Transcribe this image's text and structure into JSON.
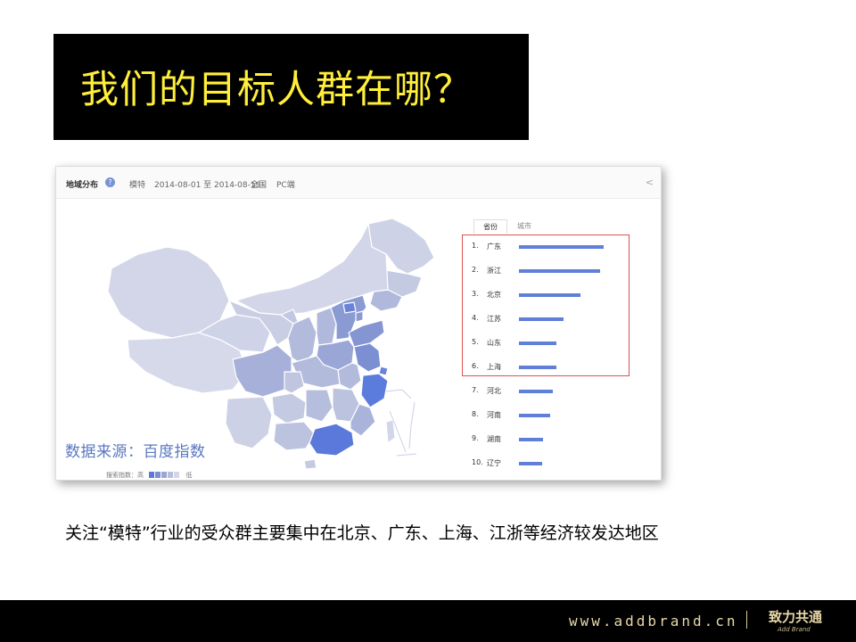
{
  "title": "我们的目标人群在哪？",
  "panel": {
    "header": {
      "title": "地域分布",
      "help_icon": "?",
      "keyword": "模特",
      "date_range": "2014-08-01 至 2014-08-19",
      "region": "全国",
      "device": "PC端",
      "share_icon": "<"
    },
    "tabs": {
      "active": "省份",
      "inactive": "城市"
    },
    "source": "数据来源：百度指数",
    "legend": {
      "left": "搜索指数：高",
      "right": "低"
    }
  },
  "chart_data": {
    "type": "bar",
    "orientation": "horizontal",
    "categories": [
      "广东",
      "浙江",
      "北京",
      "江苏",
      "山东",
      "上海",
      "河北",
      "河南",
      "湖南",
      "辽宁"
    ],
    "ranks": [
      "1.",
      "2.",
      "3.",
      "4.",
      "5.",
      "6.",
      "7.",
      "8.",
      "9.",
      "10."
    ],
    "values": [
      95,
      91,
      69,
      50,
      42,
      42,
      38,
      35,
      27,
      26
    ],
    "xlim": [
      0,
      100
    ],
    "bar_color": "#5f7fd8",
    "highlight_top": 6
  },
  "description": "关注“模特”行业的受众群主要集中在北京、广东、上海、江浙等经济较发达地区",
  "footer": {
    "url": "www.addbrand.cn",
    "brand": "致力共通",
    "brand_sub": "Add Brand"
  },
  "colors": {
    "title_bg": "#000000",
    "title_text": "#ffef3a",
    "accent": "#5f7fd8",
    "highlight": "#d9534f"
  }
}
